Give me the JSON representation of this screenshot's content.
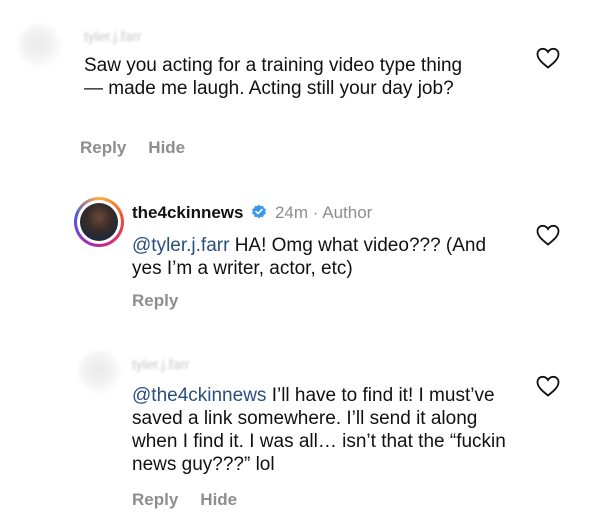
{
  "comments": [
    {
      "username": "tyler.j.farr",
      "text": "Saw you acting for a training video type thing — made me laugh. Acting still your day job?",
      "actions": {
        "reply": "Reply",
        "hide": "Hide"
      },
      "icon": "heart-outline-icon"
    },
    {
      "username": "the4ckinnews",
      "verified_icon": "verified-badge-icon",
      "time": "24m",
      "separator": "·",
      "role": "Author",
      "mention": "@tyler.j.farr",
      "text": " HA! Omg what video??? (And yes I’m a writer, actor, etc)",
      "actions": {
        "reply": "Reply"
      },
      "icon": "heart-outline-icon"
    },
    {
      "username": "tyler.j.farr",
      "mention": "@the4ckinnews",
      "text": " I’ll have to find it! I must’ve saved a link somewhere. I’ll send it along when I find it. I was all… isn’t that the “fuckin news guy???” lol",
      "actions": {
        "reply": "Reply",
        "hide": "Hide"
      },
      "icon": "heart-outline-icon"
    }
  ],
  "colors": {
    "verified": "#3897f0",
    "muted": "#8e8e8e",
    "mention": "#2b4e7e"
  }
}
